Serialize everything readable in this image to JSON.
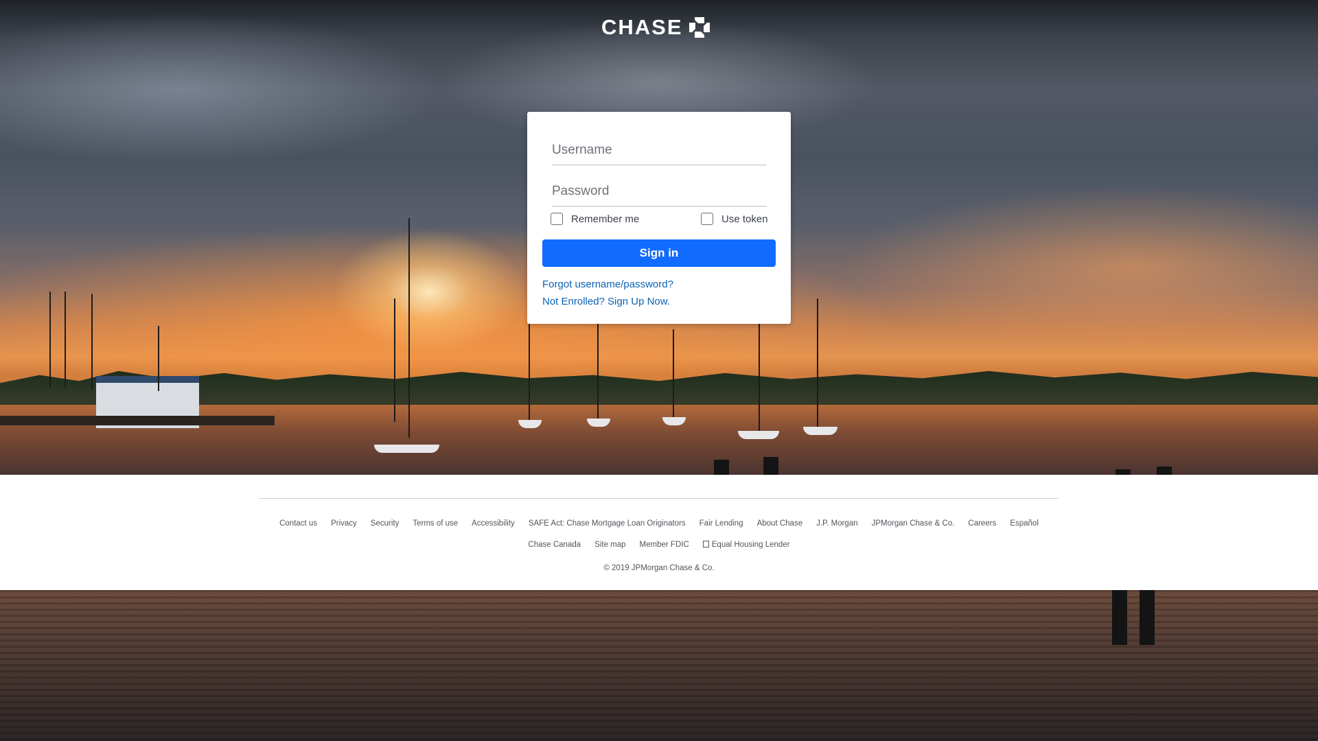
{
  "header": {
    "brand": "CHASE"
  },
  "login": {
    "username_placeholder": "Username",
    "password_placeholder": "Password",
    "remember_me_label": "Remember me",
    "use_token_label": "Use token",
    "signin_label": "Sign in",
    "forgot_link": "Forgot username/password?",
    "enroll_link": "Not Enrolled? Sign Up Now."
  },
  "footer": {
    "row1": [
      "Contact us",
      "Privacy",
      "Security",
      "Terms of use",
      "Accessibility",
      "SAFE Act: Chase Mortgage Loan Originators",
      "Fair Lending",
      "About Chase",
      "J.P. Morgan",
      "JPMorgan Chase & Co.",
      "Careers",
      "Español"
    ],
    "row2": [
      "Chase Canada",
      "Site map",
      "Member FDIC",
      "Equal Housing Lender"
    ],
    "copyright": "© 2019 JPMorgan Chase & Co."
  },
  "colors": {
    "brand_blue": "#126bff",
    "link_blue": "#0b62b3"
  }
}
